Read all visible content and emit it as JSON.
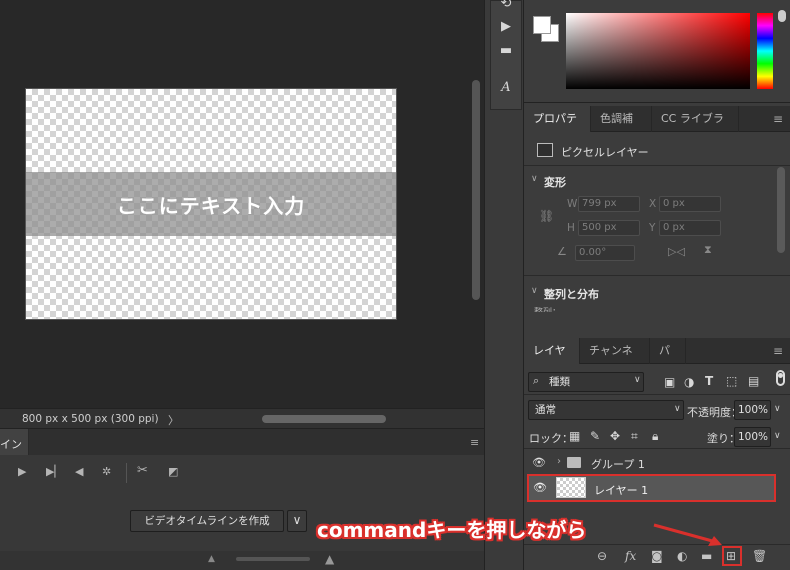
{
  "canvas": {
    "text_layer": "ここにテキスト入力",
    "status": "800 px x 500 px (300 ppi)",
    "status_arrow": "〉"
  },
  "timeline": {
    "tab_label": "イン",
    "create_button": "ビデオタイムラインを作成",
    "dropdown_arrow": "∨",
    "menu_glyph": "≡"
  },
  "properties": {
    "tabs": [
      "プロパティ",
      "色調補正",
      "CC ライブラリ"
    ],
    "layer_type": "ピクセルレイヤー",
    "transform_title": "変形",
    "w_label": "W",
    "w_value": "799 px",
    "h_label": "H",
    "h_value": "500 px",
    "x_label": "X",
    "x_value": "0 px",
    "y_label": "Y",
    "y_value": "0 px",
    "angle_value": "0.00°",
    "align_title": "整列と分布",
    "align_sub": "整列："
  },
  "layers": {
    "tabs": [
      "レイヤー",
      "チャンネル",
      "パス"
    ],
    "filter_kind": "種類",
    "blend_mode": "通常",
    "opacity_label": "不透明度：",
    "opacity_value": "100%",
    "lock_label": "ロック：",
    "fill_label": "塗り：",
    "fill_value": "100%",
    "group_name": "グループ 1",
    "layer_name": "レイヤー 1"
  },
  "annotation": {
    "callout": "commandキーを押しながら",
    "color": "#d9302c"
  },
  "icons": [
    "search-icon",
    "eye-icon",
    "folder-icon",
    "link-icon",
    "fx-icon",
    "mask-icon",
    "adjustment-icon",
    "new-layer-icon",
    "trash-icon",
    "play-icon",
    "scissors-icon",
    "menu-icon"
  ]
}
